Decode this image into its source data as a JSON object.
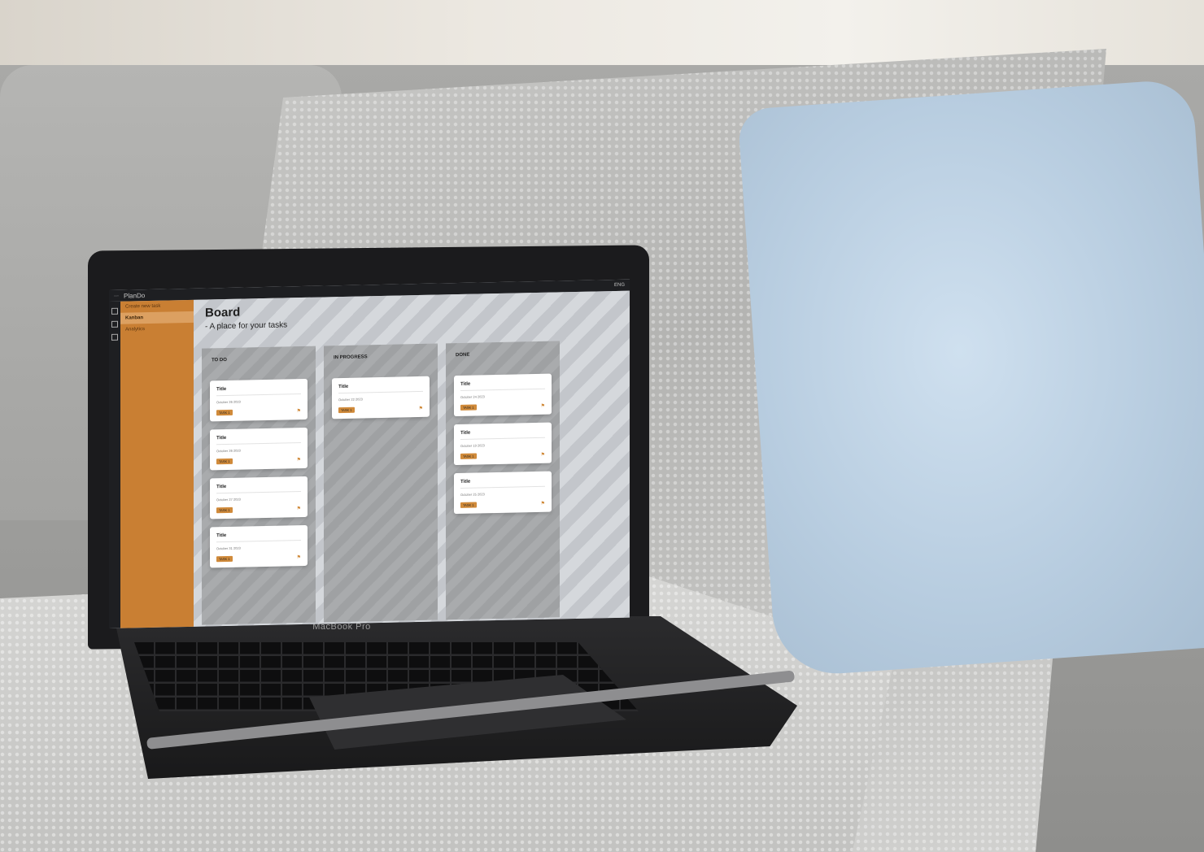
{
  "app": {
    "name": "PlanDo",
    "lang": "ENG"
  },
  "sidebar": {
    "items": [
      {
        "label": "Create new task"
      },
      {
        "label": "Kanban"
      },
      {
        "label": "Analytics"
      }
    ]
  },
  "board": {
    "title": "Board",
    "subtitle": "- A place for your tasks",
    "columns": [
      {
        "title": "TO DO",
        "cards": [
          {
            "title": "Title",
            "date": "October 26 2023",
            "tag": "TASK 1"
          },
          {
            "title": "Title",
            "date": "October 26 2023",
            "tag": "TASK 1"
          },
          {
            "title": "Title",
            "date": "October 27 2023",
            "tag": "TASK 1"
          },
          {
            "title": "Title",
            "date": "October 31 2023",
            "tag": "TASK 1"
          }
        ]
      },
      {
        "title": "IN PROGRESS",
        "cards": [
          {
            "title": "Title",
            "date": "October 22 2023",
            "tag": "TASK 1"
          }
        ]
      },
      {
        "title": "DONE",
        "cards": [
          {
            "title": "Title",
            "date": "October 24 2023",
            "tag": "TASK 1"
          },
          {
            "title": "Title",
            "date": "October 19 2023",
            "tag": "TASK 1"
          },
          {
            "title": "Title",
            "date": "October 25 2023",
            "tag": "TASK 1"
          }
        ]
      }
    ]
  },
  "device": {
    "model": "MacBook Pro"
  },
  "colors": {
    "accent": "#c97f33"
  }
}
